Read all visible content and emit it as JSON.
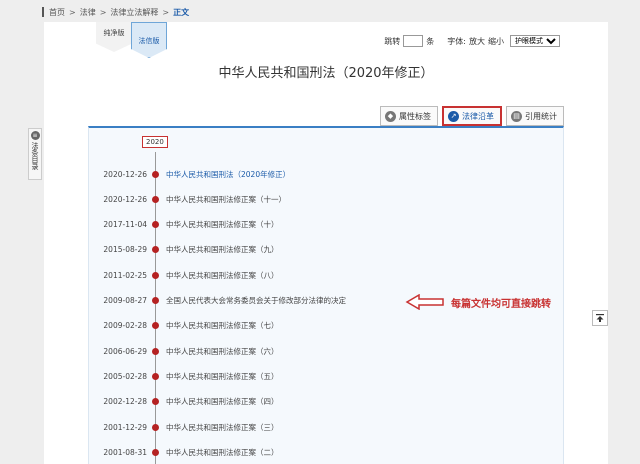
{
  "breadcrumb": {
    "items": [
      "首页",
      "法律",
      "法律立法解释"
    ],
    "sep": ">",
    "current": "正文"
  },
  "version_tabs": {
    "pure": "纯净版",
    "legal": "法信版"
  },
  "toolbar": {
    "jump_label": "跳转",
    "jump_value": "",
    "jump_unit": "条",
    "font_label": "字体:",
    "enlarge": "放大",
    "shrink": "缩小",
    "mode_value": "护眼模式"
  },
  "title": "中华人民共和国刑法（2020年修正）",
  "tabs": [
    {
      "label": "属性标签",
      "icon": "tag-icon",
      "active": false
    },
    {
      "label": "法律沿革",
      "icon": "history-icon",
      "active": true
    },
    {
      "label": "引用统计",
      "icon": "stats-icon",
      "active": false
    }
  ],
  "timeline": {
    "year": "2020",
    "entries": [
      {
        "date": "2020-12-26",
        "name": "中华人民共和国刑法（2020年修正）"
      },
      {
        "date": "2020-12-26",
        "name": "中华人民共和国刑法修正案（十一）"
      },
      {
        "date": "2017-11-04",
        "name": "中华人民共和国刑法修正案（十）"
      },
      {
        "date": "2015-08-29",
        "name": "中华人民共和国刑法修正案（九）"
      },
      {
        "date": "2011-02-25",
        "name": "中华人民共和国刑法修正案（八）"
      },
      {
        "date": "2009-08-27",
        "name": "全国人民代表大会常务委员会关于修改部分法律的决定"
      },
      {
        "date": "2009-02-28",
        "name": "中华人民共和国刑法修正案（七）"
      },
      {
        "date": "2006-06-29",
        "name": "中华人民共和国刑法修正案（六）"
      },
      {
        "date": "2005-02-28",
        "name": "中华人民共和国刑法修正案（五）"
      },
      {
        "date": "2002-12-28",
        "name": "中华人民共和国刑法修正案（四）"
      },
      {
        "date": "2001-12-29",
        "name": "中华人民共和国刑法修正案（三）"
      },
      {
        "date": "2001-08-31",
        "name": "中华人民共和国刑法修正案（二）"
      }
    ]
  },
  "annotation": "每篇文件均可直接跳转",
  "side_toc": {
    "label": "法条目录"
  },
  "colors": {
    "accent": "#1a5aa8",
    "highlight": "#c83232",
    "panel": "#f5f9fd"
  }
}
